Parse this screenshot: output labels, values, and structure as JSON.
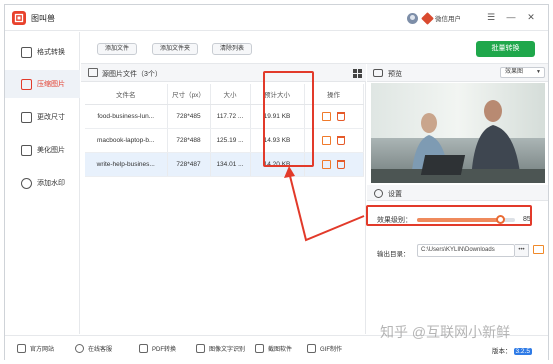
{
  "app": {
    "title": "图叫兽"
  },
  "user": {
    "name": "微信用户"
  },
  "window_controls": {
    "menu": "☰",
    "minimize": "—",
    "close": "✕"
  },
  "sidebar": {
    "items": [
      {
        "label": "格式转换",
        "active": false
      },
      {
        "label": "压缩图片",
        "active": true
      },
      {
        "label": "更改尺寸",
        "active": false
      },
      {
        "label": "美化图片",
        "active": false
      },
      {
        "label": "添加水印",
        "active": false
      }
    ]
  },
  "toolbar": {
    "add_file": "添加文件",
    "add_folder": "添加文件夹",
    "clear_list": "清除列表",
    "batch_convert": "批量转换"
  },
  "file_panel": {
    "title": "源图片文件（3个）",
    "columns": [
      "文件名",
      "尺寸（px）",
      "大小",
      "预计大小",
      "操作"
    ],
    "rows": [
      {
        "name": "food-business-lun...",
        "dims": "728*485",
        "size": "117.72 ...",
        "estimated": "19.91 KB"
      },
      {
        "name": "macbook-laptop-b...",
        "dims": "728*488",
        "size": "125.19 ...",
        "estimated": "14.93 KB"
      },
      {
        "name": "write-help-busines...",
        "dims": "728*487",
        "size": "134.01 ...",
        "estimated": "14.20 KB"
      }
    ]
  },
  "preview": {
    "title": "预览",
    "mode": "效果图"
  },
  "settings": {
    "title": "设置",
    "level_label": "效果级别：",
    "level_value": "85",
    "level_fraction": 0.85,
    "output_label": "输出目录：",
    "output_path": "C:\\Users\\KYLIN\\Downloads",
    "more": "•••"
  },
  "bottom": {
    "items": [
      "官方网站",
      "在线客服",
      "PDF转换",
      "图像文字识别",
      "截图软件",
      "GIF制作"
    ],
    "version_label": "版本：",
    "version": "3.2.5"
  },
  "watermark": "知乎 @互联网小新鲜",
  "colors": {
    "accent_red": "#e23a2a",
    "green": "#1fa74b",
    "orange": "#ef8a5c"
  }
}
